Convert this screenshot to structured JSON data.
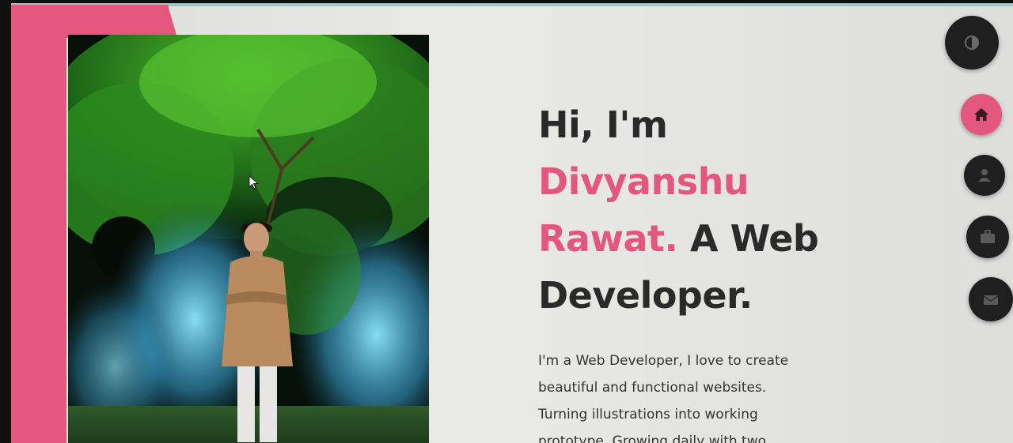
{
  "hero": {
    "greeting": "Hi, I'm",
    "name_line1": "Divyanshu",
    "name_line2": "Rawat.",
    "role_part1": "A Web",
    "role_part2": "Developer."
  },
  "about": {
    "line1": "I'm a Web Developer, I love to create",
    "line2": "beautiful and functional websites.",
    "line3": "Turning illustrations into working",
    "line4": "prototype. Growing daily with two"
  },
  "nav": {
    "buttons": [
      {
        "id": "theme",
        "icon": "contrast-icon"
      },
      {
        "id": "home",
        "icon": "home-icon",
        "active": true
      },
      {
        "id": "about",
        "icon": "user-icon"
      },
      {
        "id": "portfolio",
        "icon": "briefcase-icon"
      },
      {
        "id": "contact",
        "icon": "envelope-icon"
      }
    ]
  },
  "colors": {
    "accent": "#e3577c",
    "dark_button": "#1f1f1f",
    "text": "#2a2a2a"
  }
}
